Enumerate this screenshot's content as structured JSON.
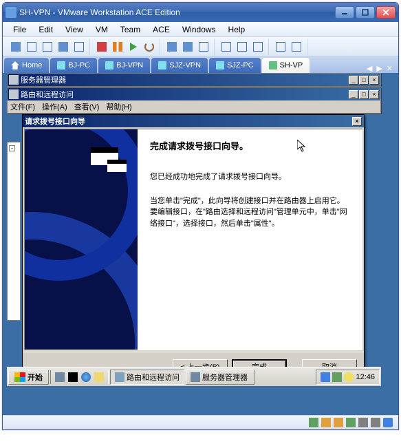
{
  "vmware": {
    "title": "SH-VPN - VMware Workstation ACE Edition",
    "menu": {
      "file": "File",
      "edit": "Edit",
      "view": "View",
      "vm": "VM",
      "team": "Team",
      "ace": "ACE",
      "windows": "Windows",
      "help": "Help"
    },
    "tabs": {
      "home": "Home",
      "items": [
        "BJ-PC",
        "BJ-VPN",
        "SJZ-VPN",
        "SJZ-PC",
        "SH-VP"
      ]
    }
  },
  "guest": {
    "server_mgr": {
      "title": "服务器管理器"
    },
    "routing": {
      "title": "路由和远程访问",
      "menu": {
        "file": "文件(F)",
        "action": "操作(A)",
        "view": "查看(V)",
        "help": "帮助(H)"
      }
    },
    "wizard": {
      "title": "请求拨号接口向导",
      "heading": "完成请求拨号接口向导。",
      "p1": "您已经成功地完成了请求拨号接口向导。",
      "p2": "当您单击\"完成\"，此向导将创建接口并在路由器上启用它。要编辑接口，在\"路由选择和远程访问\"管理单元中，单击\"网络接口\"，选择接口，然后单击\"属性\"。",
      "btn_back": "< 上一步(B)",
      "btn_finish": "完成",
      "btn_cancel": "取消"
    },
    "taskbar": {
      "start": "开始",
      "task_routing": "路由和远程访问",
      "task_server": "服务器管理器",
      "clock": "12:46"
    }
  }
}
